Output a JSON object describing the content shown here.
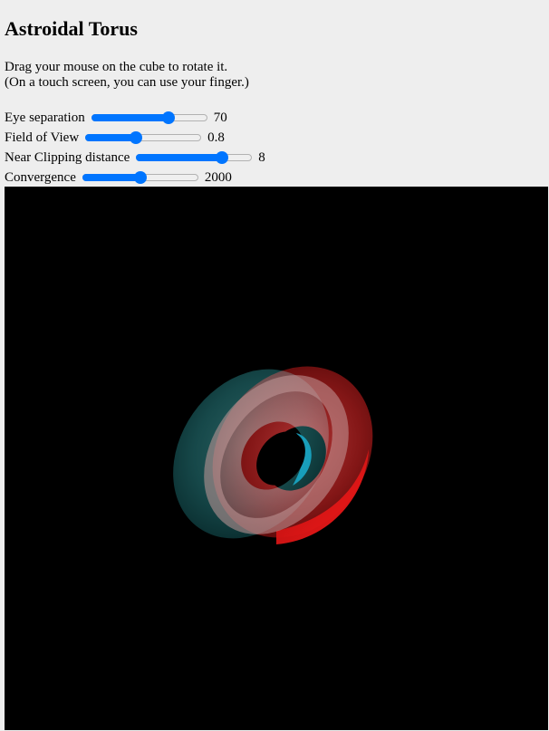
{
  "title": "Astroidal Torus",
  "instructions": [
    "Drag your mouse on the cube to rotate it.",
    "(On a touch screen, you can use your finger.)"
  ],
  "controls": [
    {
      "label": "Eye separation",
      "value": "70",
      "fraction": 0.68
    },
    {
      "label": "Field of View",
      "value": "0.8",
      "fraction": 0.43
    },
    {
      "label": "Near Clipping distance",
      "value": "8",
      "fraction": 0.77
    },
    {
      "label": "Convergence",
      "value": "2000",
      "fraction": 0.5
    }
  ],
  "colors": {
    "accent": "#0075ff",
    "background": "#eeeeee",
    "canvas": "#000000",
    "left_eye": "#00c8c8",
    "right_eye": "#ff1010"
  }
}
